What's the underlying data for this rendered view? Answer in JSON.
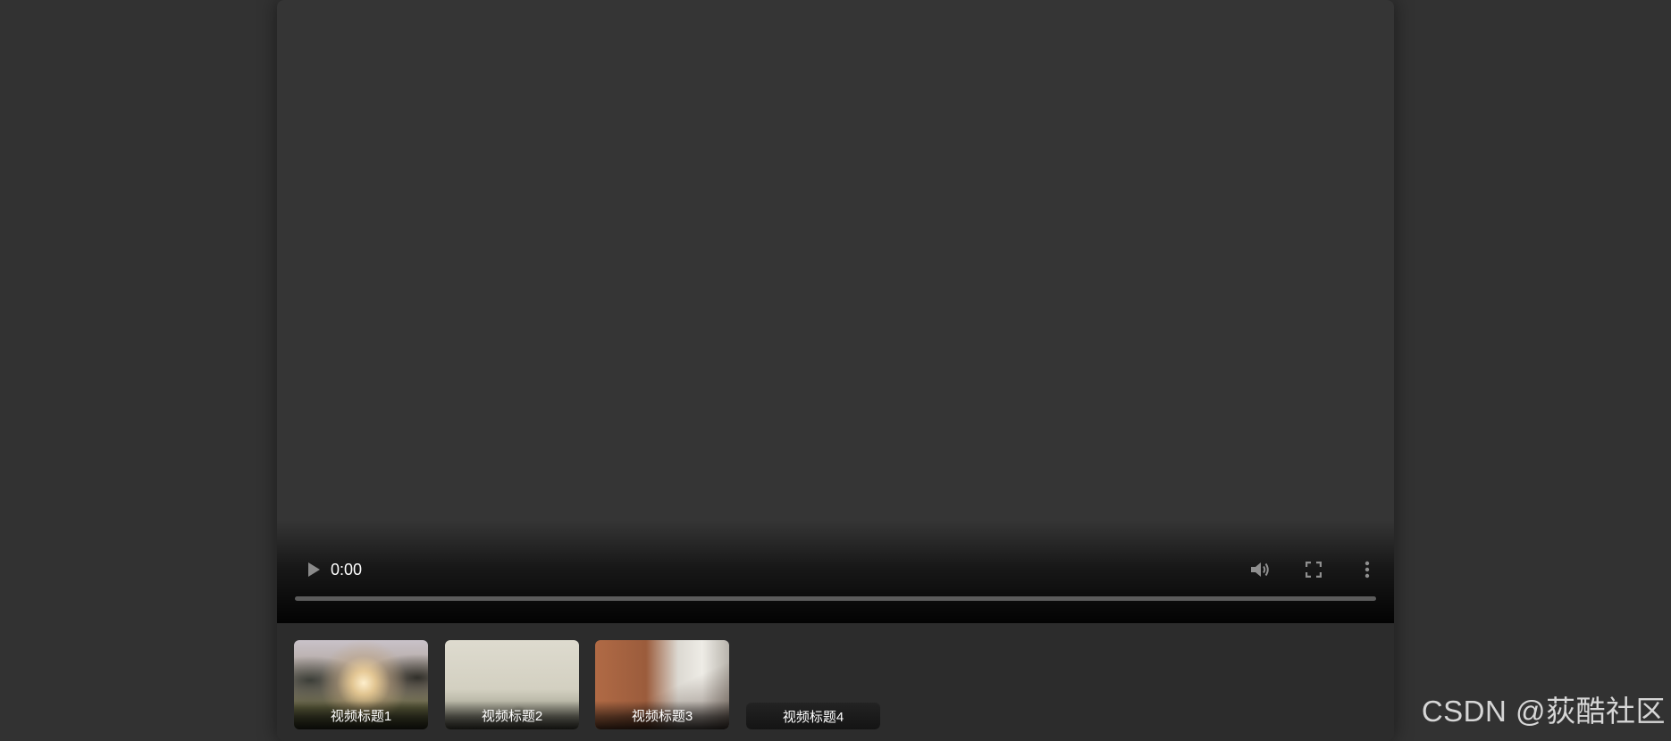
{
  "player": {
    "current_time": "0:00",
    "progress": 0,
    "icons": {
      "play": "play-icon",
      "volume": "volume-icon",
      "fullscreen": "fullscreen-icon",
      "more": "more-vertical-icon"
    }
  },
  "playlist": [
    {
      "title": "视频标题1"
    },
    {
      "title": "视频标题2"
    },
    {
      "title": "视频标题3"
    },
    {
      "title": "视频标题4"
    }
  ],
  "watermark": "CSDN @荻酷社区"
}
